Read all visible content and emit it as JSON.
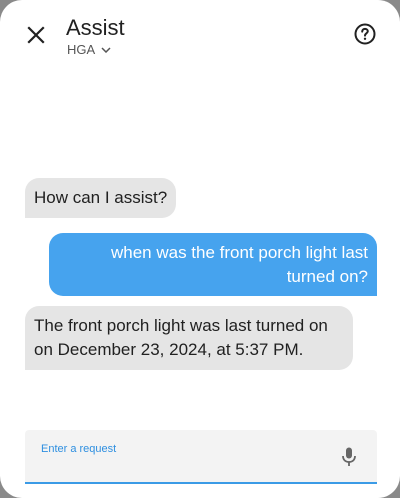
{
  "header": {
    "title": "Assist",
    "pipeline": "HGA"
  },
  "messages": [
    {
      "role": "assistant",
      "text": "How can I assist?"
    },
    {
      "role": "user",
      "text": "when was the front porch light last turned on?"
    },
    {
      "role": "assistant",
      "text": "The front porch light was last turned on on December 23, 2024, at 5:37 PM."
    }
  ],
  "input": {
    "label": "Enter a request",
    "value": ""
  },
  "icons": {
    "close": "close-icon",
    "help": "help-circle-icon",
    "dropdown": "chevron-down-icon",
    "mic": "microphone-icon"
  },
  "colors": {
    "user_bubble": "#46a3ee",
    "assistant_bubble": "#e5e5e5",
    "accent": "#3b9be6"
  }
}
